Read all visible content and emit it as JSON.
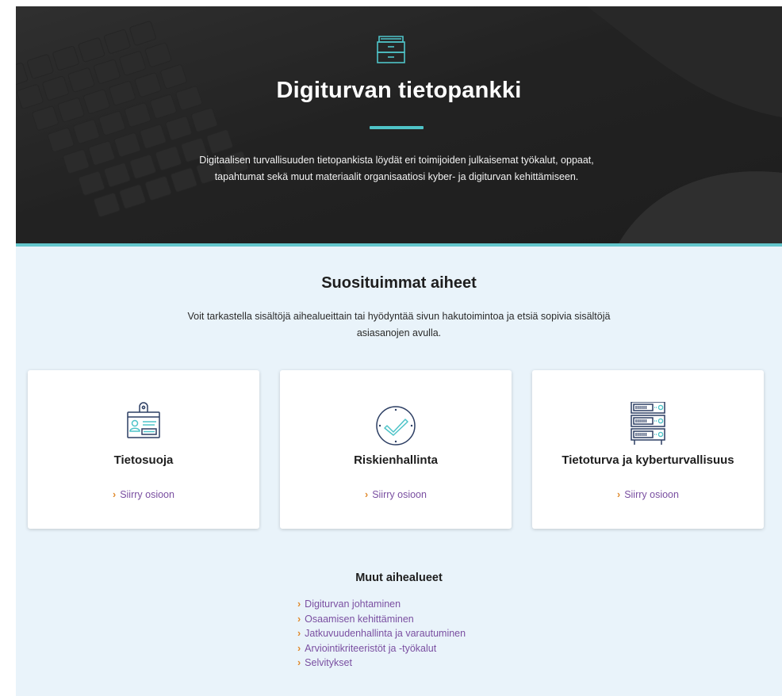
{
  "hero": {
    "title": "Digiturvan tietopankki",
    "description": "Digitaalisen turvallisuuden tietopankista löydät eri toimijoiden julkaisemat työkalut, oppaat, tapahtumat sekä muut materiaalit organisaatiosi kyber- ja digiturvan kehittämiseen.",
    "icon": "archive-drawers-icon"
  },
  "popular": {
    "title": "Suosituimmat aiheet",
    "description": "Voit tarkastella sisältöjä aihealueittain tai hyödyntää sivun hakutoimintoa ja etsiä sopivia sisältöjä asiasanojen avulla.",
    "cards": [
      {
        "title": "Tietosuoja",
        "link": "Siirry osioon",
        "icon": "id-badge-icon"
      },
      {
        "title": "Riskienhallinta",
        "link": "Siirry osioon",
        "icon": "check-circle-icon"
      },
      {
        "title": "Tietoturva ja kyberturvallisuus",
        "link": "Siirry osioon",
        "icon": "server-rack-icon"
      }
    ]
  },
  "other": {
    "title": "Muut aihealueet",
    "items": [
      "Digiturvan johtaminen",
      "Osaamisen kehittäminen",
      "Jatkuvuudenhallinta ja varautuminen",
      "Arviointikriteeristöt ja -työkalut",
      "Selvitykset"
    ]
  },
  "colors": {
    "accent": "#4fc4c8",
    "link": "#7a4fa1",
    "chevron": "#e08a2c",
    "hero_bg": "#2b2b2b",
    "content_bg": "#e9f3fa",
    "icon_navy": "#2c3e63"
  }
}
